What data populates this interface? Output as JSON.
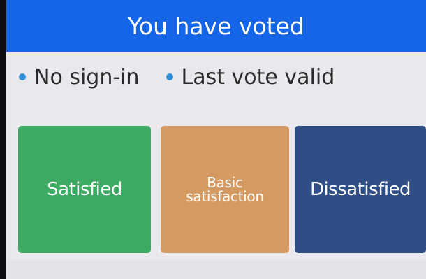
{
  "header": {
    "title": "You have voted"
  },
  "info": {
    "items": [
      {
        "label": "No sign-in"
      },
      {
        "label": "Last vote valid"
      }
    ]
  },
  "vote_options": [
    {
      "label": "Satisfied",
      "color": "#3caa62"
    },
    {
      "label_line1": "Basic",
      "label_line2": "satisfaction",
      "color": "#d59a62"
    },
    {
      "label": "Dissatisfied",
      "color": "#2f4e86"
    }
  ],
  "colors": {
    "header_bg": "#1565e8",
    "screen_bg": "#e9e8ec",
    "bullet": "#2f8fd8"
  }
}
